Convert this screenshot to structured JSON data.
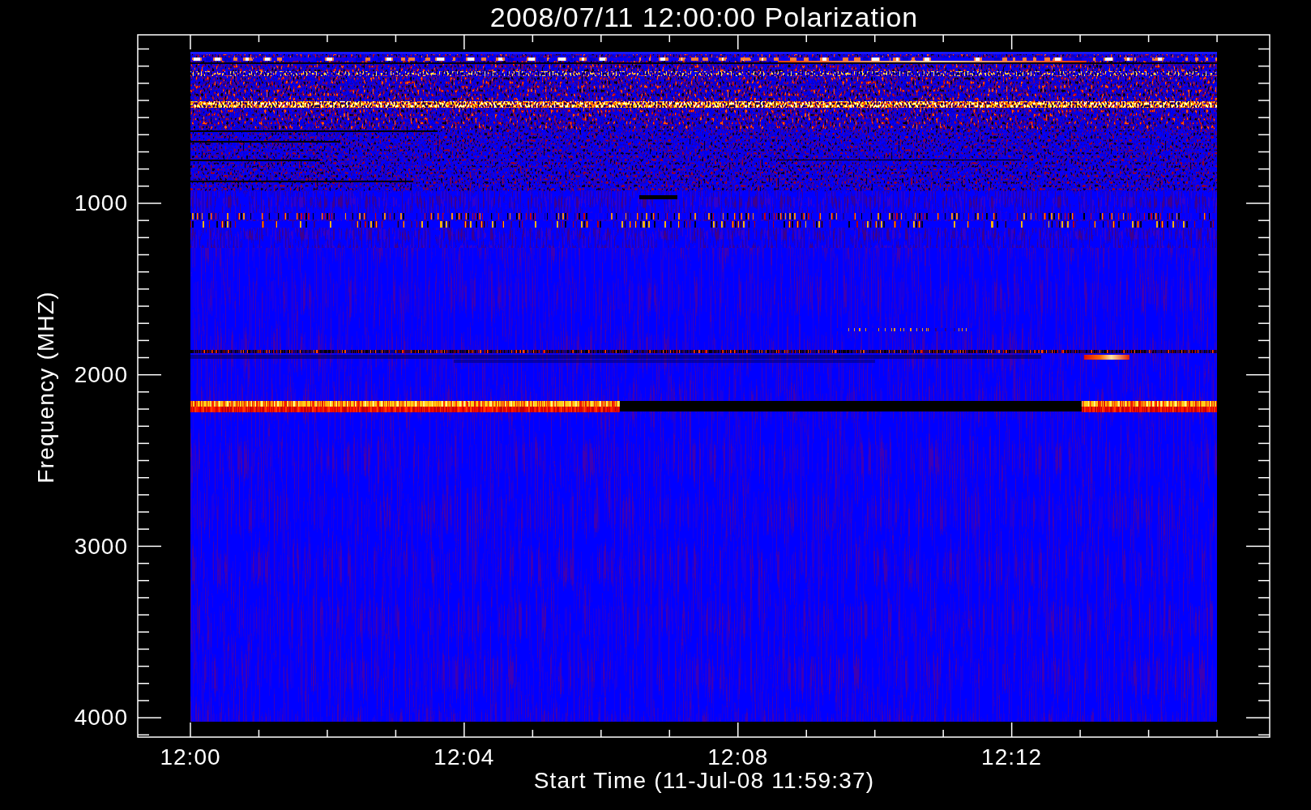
{
  "plot": {
    "title": "2008/07/11 12:00:00 Polarization",
    "y_axis": {
      "label": "Frequency (MHZ)",
      "ticks": [
        "1000",
        "2000",
        "3000",
        "4000"
      ]
    },
    "x_axis": {
      "ticks": [
        "12:00",
        "12:04",
        "12:08",
        "12:12"
      ],
      "label": "Start Time (11-Jul-08 11:59:37)"
    }
  }
}
